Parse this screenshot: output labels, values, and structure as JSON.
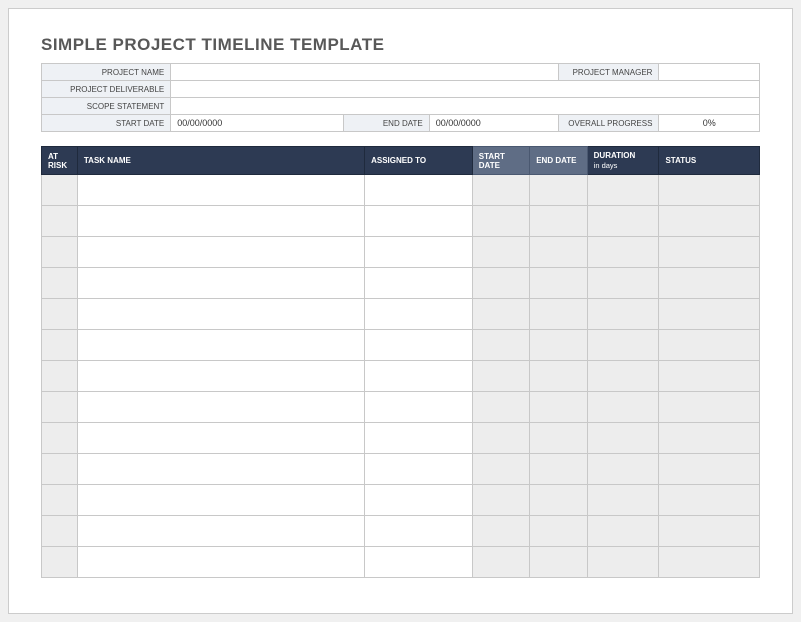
{
  "title": "SIMPLE PROJECT TIMELINE TEMPLATE",
  "meta": {
    "project_name_label": "PROJECT NAME",
    "project_name_value": "",
    "project_manager_label": "PROJECT MANAGER",
    "project_manager_value": "",
    "project_deliverable_label": "PROJECT DELIVERABLE",
    "project_deliverable_value": "",
    "scope_statement_label": "SCOPE STATEMENT",
    "scope_statement_value": "",
    "start_date_label": "START DATE",
    "start_date_value": "00/00/0000",
    "end_date_label": "END DATE",
    "end_date_value": "00/00/0000",
    "overall_progress_label": "OVERALL PROGRESS",
    "overall_progress_value": "0%"
  },
  "task_headers": {
    "at_risk": "AT RISK",
    "task_name": "TASK NAME",
    "assigned_to": "ASSIGNED TO",
    "start_date": "START DATE",
    "end_date": "END DATE",
    "duration": "DURATION",
    "duration_sub": "in days",
    "status": "STATUS"
  },
  "task_rows": [
    {
      "at_risk": "",
      "task_name": "",
      "assigned_to": "",
      "start_date": "",
      "end_date": "",
      "duration": "",
      "status": ""
    },
    {
      "at_risk": "",
      "task_name": "",
      "assigned_to": "",
      "start_date": "",
      "end_date": "",
      "duration": "",
      "status": ""
    },
    {
      "at_risk": "",
      "task_name": "",
      "assigned_to": "",
      "start_date": "",
      "end_date": "",
      "duration": "",
      "status": ""
    },
    {
      "at_risk": "",
      "task_name": "",
      "assigned_to": "",
      "start_date": "",
      "end_date": "",
      "duration": "",
      "status": ""
    },
    {
      "at_risk": "",
      "task_name": "",
      "assigned_to": "",
      "start_date": "",
      "end_date": "",
      "duration": "",
      "status": ""
    },
    {
      "at_risk": "",
      "task_name": "",
      "assigned_to": "",
      "start_date": "",
      "end_date": "",
      "duration": "",
      "status": ""
    },
    {
      "at_risk": "",
      "task_name": "",
      "assigned_to": "",
      "start_date": "",
      "end_date": "",
      "duration": "",
      "status": ""
    },
    {
      "at_risk": "",
      "task_name": "",
      "assigned_to": "",
      "start_date": "",
      "end_date": "",
      "duration": "",
      "status": ""
    },
    {
      "at_risk": "",
      "task_name": "",
      "assigned_to": "",
      "start_date": "",
      "end_date": "",
      "duration": "",
      "status": ""
    },
    {
      "at_risk": "",
      "task_name": "",
      "assigned_to": "",
      "start_date": "",
      "end_date": "",
      "duration": "",
      "status": ""
    },
    {
      "at_risk": "",
      "task_name": "",
      "assigned_to": "",
      "start_date": "",
      "end_date": "",
      "duration": "",
      "status": ""
    },
    {
      "at_risk": "",
      "task_name": "",
      "assigned_to": "",
      "start_date": "",
      "end_date": "",
      "duration": "",
      "status": ""
    },
    {
      "at_risk": "",
      "task_name": "",
      "assigned_to": "",
      "start_date": "",
      "end_date": "",
      "duration": "",
      "status": ""
    }
  ]
}
